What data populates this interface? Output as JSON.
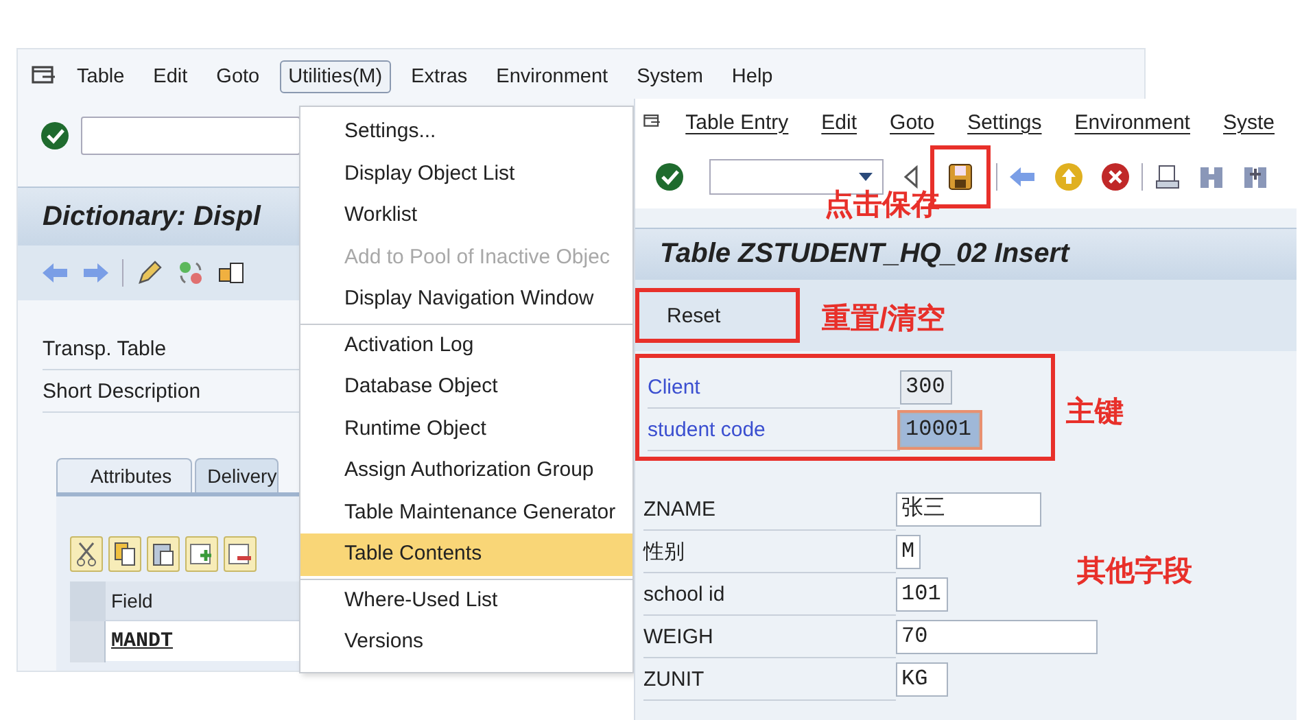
{
  "left_window": {
    "menu": [
      {
        "label": "Table",
        "selected": false
      },
      {
        "label": "Edit",
        "selected": false
      },
      {
        "label": "Goto",
        "selected": false
      },
      {
        "label": "Utilities(M)",
        "selected": true
      },
      {
        "label": "Extras",
        "selected": false
      },
      {
        "label": "Environment",
        "selected": false
      },
      {
        "label": "System",
        "selected": false
      },
      {
        "label": "Help",
        "selected": false
      }
    ],
    "title": "Dictionary: Displ",
    "toolbar_icons": [
      {
        "kind": "back"
      },
      {
        "kind": "forward"
      },
      {
        "kind": "pencil"
      },
      {
        "kind": "switch"
      },
      {
        "kind": "object"
      }
    ],
    "fields": [
      {
        "label": "Transp. Table"
      },
      {
        "label": "Short Description"
      }
    ],
    "tabs": [
      {
        "label": "Attributes",
        "selected": true
      },
      {
        "label": "Delivery",
        "selected": false
      }
    ],
    "table_icons": [
      {
        "kind": "cut"
      },
      {
        "kind": "copy"
      },
      {
        "kind": "paste"
      },
      {
        "kind": "insert-row"
      },
      {
        "kind": "delete-row"
      }
    ],
    "table": {
      "columns": [
        "Field"
      ],
      "rows": [
        [
          "MANDT"
        ]
      ]
    }
  },
  "utilities_menu": {
    "groups": [
      [
        {
          "label": "Settings...",
          "disabled": false,
          "selected": false
        },
        {
          "label": "Display Object List",
          "disabled": false,
          "selected": false
        },
        {
          "label": "Worklist",
          "disabled": false,
          "selected": false
        },
        {
          "label": "Add to Pool of Inactive Objec",
          "disabled": true,
          "selected": false
        },
        {
          "label": "Display Navigation Window",
          "disabled": false,
          "selected": false
        }
      ],
      [
        {
          "label": "Activation Log",
          "disabled": false,
          "selected": false
        },
        {
          "label": "Database Object",
          "disabled": false,
          "selected": false
        },
        {
          "label": "Runtime Object",
          "disabled": false,
          "selected": false
        },
        {
          "label": "Assign Authorization Group",
          "disabled": false,
          "selected": false
        },
        {
          "label": "Table Maintenance Generator",
          "disabled": false,
          "selected": false
        },
        {
          "label": "Table Contents",
          "disabled": false,
          "selected": true
        }
      ],
      [
        {
          "label": "Where-Used List",
          "disabled": false,
          "selected": false
        },
        {
          "label": "Versions",
          "disabled": false,
          "selected": false
        }
      ]
    ]
  },
  "right_window": {
    "menu": [
      {
        "label": "Table Entry"
      },
      {
        "label": "Edit"
      },
      {
        "label": "Goto"
      },
      {
        "label": "Settings"
      },
      {
        "label": "Environment"
      },
      {
        "label": "Syste"
      }
    ],
    "toolbar_icons": [
      {
        "kind": "enter",
        "highlighted": false
      },
      {
        "kind": "back-triangle",
        "highlighted": false
      },
      {
        "kind": "save",
        "highlighted": true
      },
      {
        "kind": "back",
        "highlighted": false
      },
      {
        "kind": "exit",
        "highlighted": false
      },
      {
        "kind": "cancel",
        "highlighted": false
      },
      {
        "kind": "print",
        "highlighted": false
      },
      {
        "kind": "find",
        "highlighted": false
      },
      {
        "kind": "find-next",
        "highlighted": false
      }
    ],
    "title": "Table ZSTUDENT_HQ_02 Insert",
    "buttons": [
      {
        "label": "Reset",
        "highlighted": true
      }
    ],
    "key_fields": {
      "highlighted": true,
      "fields": [
        {
          "label": "Client",
          "value": "300",
          "focused": false
        },
        {
          "label": "student code",
          "value": "10001",
          "focused": true
        }
      ]
    },
    "fields": [
      {
        "label": "ZNAME",
        "value": "张三"
      },
      {
        "label": "性别",
        "value": "M"
      },
      {
        "label": "school id",
        "value": "101"
      },
      {
        "label": "WEIGH",
        "value": "70"
      },
      {
        "label": "ZUNIT",
        "value": "KG"
      }
    ],
    "annotations": [
      {
        "text": "点击保存"
      },
      {
        "text": "重置/清空"
      },
      {
        "text": "主键"
      },
      {
        "text": "其他字段"
      }
    ]
  }
}
